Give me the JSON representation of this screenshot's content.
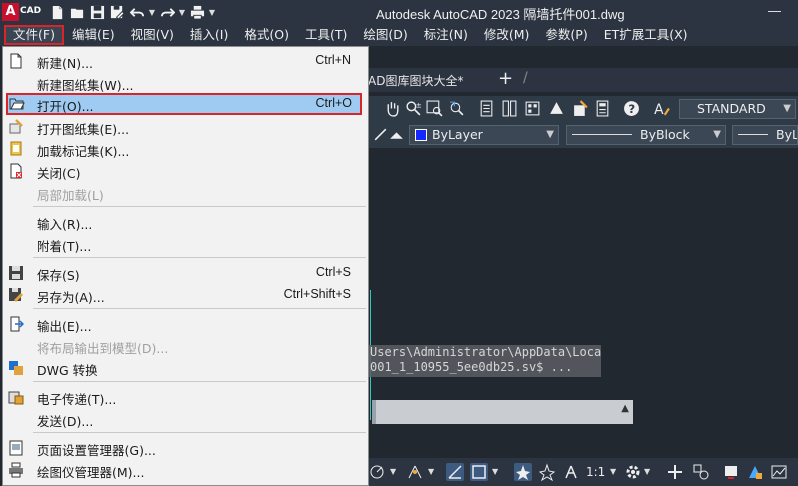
{
  "app": {
    "logo_letter": "A",
    "logo_text": "CAD",
    "window_title": "Autodesk AutoCAD 2023    隔墙托件001.dwg"
  },
  "quick_access": [
    "new-icon",
    "open-icon",
    "save-icon",
    "save-as-icon",
    "undo-icon",
    "redo-icon",
    "plot-icon"
  ],
  "menubar": {
    "items": [
      "文件(F)",
      "编辑(E)",
      "视图(V)",
      "插入(I)",
      "格式(O)",
      "工具(T)",
      "绘图(D)",
      "标注(N)",
      "修改(M)",
      "参数(P)",
      "ET扩展工具(X)"
    ],
    "active_index": 0
  },
  "doc_tabs": {
    "tab_label": "AD图库图块大全*",
    "new_tab_symbol": "+"
  },
  "ribbon": {
    "text_style": "STANDARD",
    "layer_color": "ByLayer",
    "linetype": "ByBlock",
    "lineweight": "ByL"
  },
  "command": {
    "history": [
      "Users\\Administrator\\AppData\\Local",
      "001_1_10955_5ee0db25.sv$ ..."
    ]
  },
  "statusbar": {
    "scale": "1:1"
  },
  "file_menu": {
    "items": [
      {
        "label": "新建(N)...",
        "shortcut": "Ctrl+N",
        "icon": "new-file-icon",
        "enabled": true
      },
      {
        "label": "新建图纸集(W)...",
        "shortcut": "",
        "icon": "",
        "enabled": true
      },
      {
        "label": "打开(O)...",
        "shortcut": "Ctrl+O",
        "icon": "open-folder-icon",
        "enabled": true,
        "highlighted": true
      },
      {
        "label": "打开图纸集(E)...",
        "shortcut": "",
        "icon": "open-sheet-set-icon",
        "enabled": true
      },
      {
        "label": "加载标记集(K)...",
        "shortcut": "",
        "icon": "markup-set-icon",
        "enabled": true
      },
      {
        "label": "关闭(C)",
        "shortcut": "",
        "icon": "close-file-icon",
        "enabled": true
      },
      {
        "label": "局部加载(L)",
        "shortcut": "",
        "icon": "",
        "enabled": false
      },
      {
        "label": "输入(R)...",
        "shortcut": "",
        "icon": "",
        "enabled": true
      },
      {
        "label": "附着(T)...",
        "shortcut": "",
        "icon": "",
        "enabled": true
      },
      {
        "label": "保存(S)",
        "shortcut": "Ctrl+S",
        "icon": "save-file-icon",
        "enabled": true
      },
      {
        "label": "另存为(A)...",
        "shortcut": "Ctrl+Shift+S",
        "icon": "save-as-file-icon",
        "enabled": true
      },
      {
        "label": "输出(E)...",
        "shortcut": "",
        "icon": "export-icon",
        "enabled": true
      },
      {
        "label": "将布局输出到模型(D)...",
        "shortcut": "",
        "icon": "",
        "enabled": false
      },
      {
        "label": "DWG 转换",
        "shortcut": "",
        "icon": "dwg-convert-icon",
        "enabled": true
      },
      {
        "label": "电子传递(T)...",
        "shortcut": "",
        "icon": "etransmit-icon",
        "enabled": true
      },
      {
        "label": "发送(D)...",
        "shortcut": "",
        "icon": "",
        "enabled": true
      },
      {
        "label": "页面设置管理器(G)...",
        "shortcut": "",
        "icon": "page-setup-icon",
        "enabled": true
      },
      {
        "label": "绘图仪管理器(M)...",
        "shortcut": "",
        "icon": "plotter-manager-icon",
        "enabled": true
      }
    ]
  },
  "colors": {
    "highlight": "#9fcbf3",
    "highlight_border": "#d9252a",
    "background": "#212830",
    "chrome": "#2b3440"
  }
}
